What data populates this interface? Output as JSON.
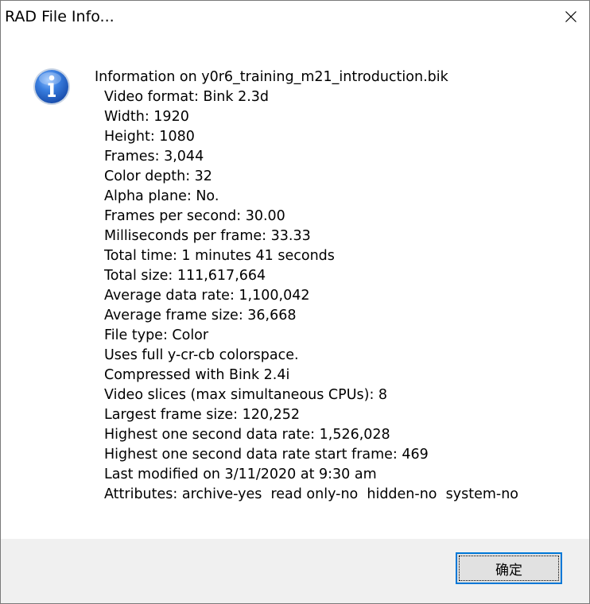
{
  "window": {
    "title": "RAD File Info..."
  },
  "message": {
    "heading": "Information on y0r6_training_m21_introduction.bik",
    "lines": [
      "Video format: Bink 2.3d",
      "Width: 1920",
      "Height: 1080",
      "Frames: 3,044",
      "Color depth: 32",
      "Alpha plane: No.",
      "Frames per second: 30.00",
      "Milliseconds per frame: 33.33",
      "Total time: 1 minutes 41 seconds",
      "Total size: 111,617,664",
      "Average data rate: 1,100,042",
      "Average frame size: 36,668",
      "File type: Color",
      "Uses full y-cr-cb colorspace.",
      "Compressed with Bink 2.4i",
      "Video slices (max simultaneous CPUs): 8",
      "Largest frame size: 120,252",
      "Highest one second data rate: 1,526,028",
      "Highest one second data rate start frame: 469",
      "Last modified on 3/11/2020 at 9:30 am",
      "Attributes: archive-yes  read only-no  hidden-no  system-no"
    ]
  },
  "buttons": {
    "ok_label": "确定"
  },
  "icons": {
    "info": "info-icon",
    "close": "close-icon"
  },
  "colors": {
    "accent": "#0078d7",
    "footer_bg": "#f0f0f0",
    "button_bg": "#e1e1e1",
    "info_icon_blue": "#1f5fc4"
  }
}
